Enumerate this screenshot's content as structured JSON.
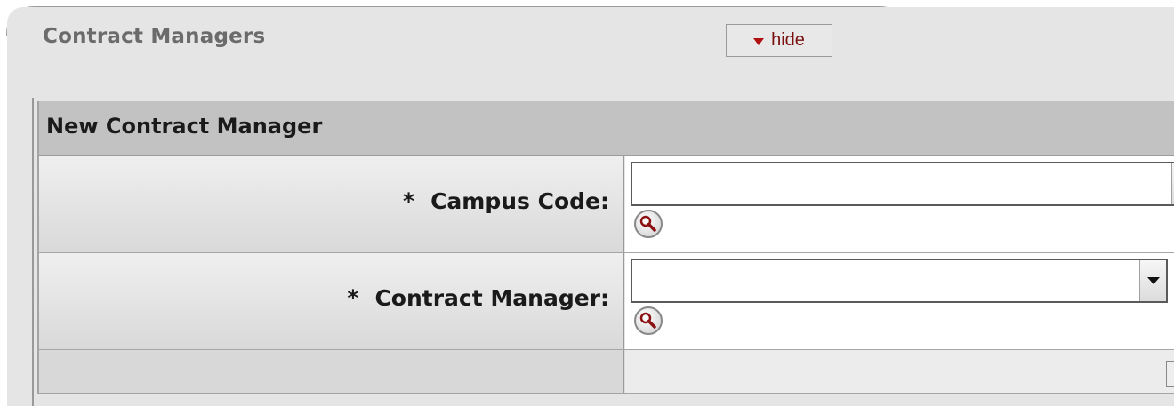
{
  "panel": {
    "title": "Contract Managers",
    "hide_label": "hide"
  },
  "section": {
    "title": "New Contract Manager"
  },
  "fields": [
    {
      "required_mark": "*",
      "label": "Campus Code:",
      "value": ""
    },
    {
      "required_mark": "*",
      "label": "Contract Manager:",
      "value": ""
    }
  ],
  "icons": {
    "lookup": "magnifier-lookup-icon",
    "dropdown": "chevron-down-icon",
    "collapse": "triangle-down-icon"
  },
  "colors": {
    "panel_bg": "#e5e5e5",
    "section_header_bg": "#c2c2c2",
    "hide_text": "#7a1010",
    "lookup_icon": "#8b1010"
  }
}
